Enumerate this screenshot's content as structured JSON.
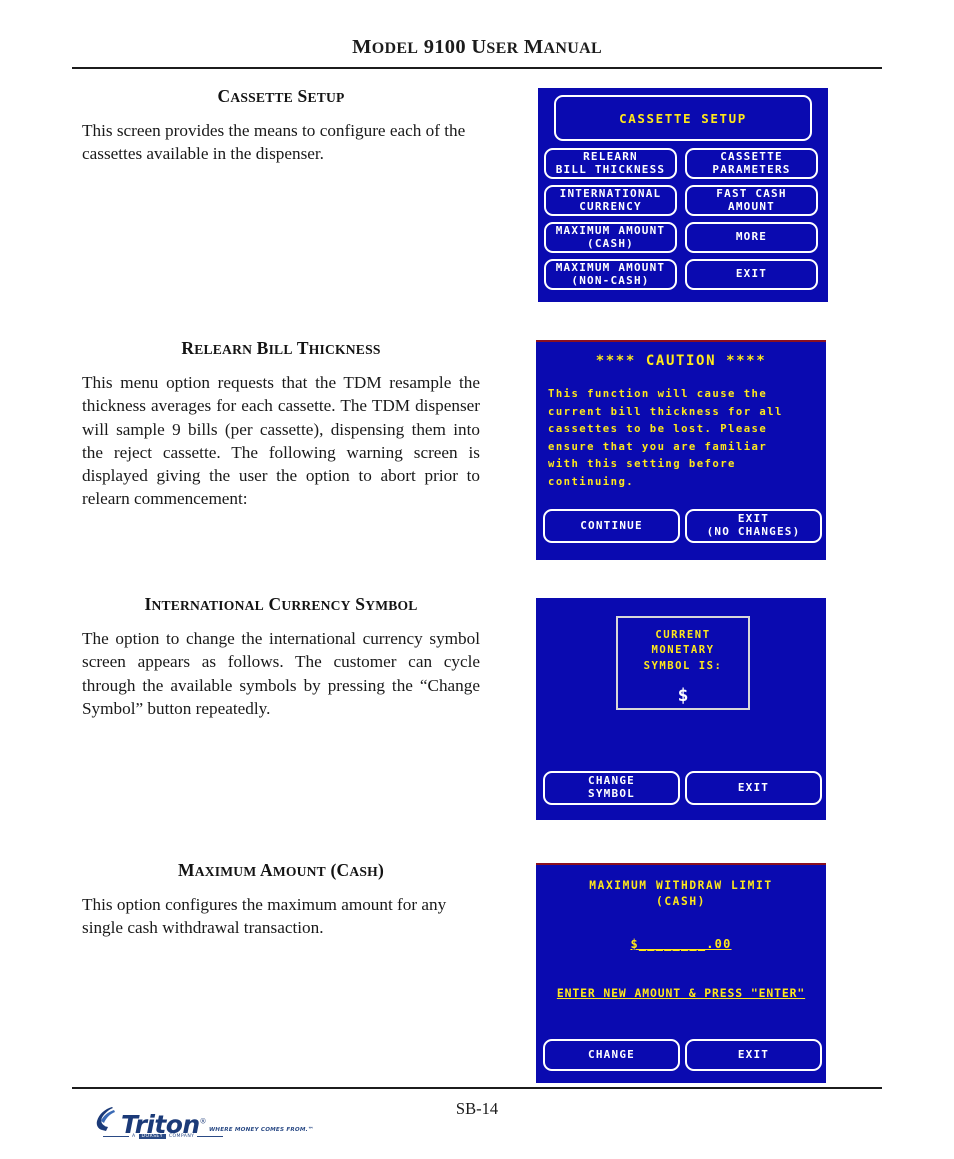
{
  "header": {
    "title_parts": [
      {
        "t": "M",
        "big": true
      },
      {
        "t": "ODEL ",
        "big": false
      },
      {
        "t": "9100 ",
        "big": true
      },
      {
        "t": "U",
        "big": true
      },
      {
        "t": "SER ",
        "big": false
      },
      {
        "t": "M",
        "big": true
      },
      {
        "t": "ANUAL",
        "big": false
      }
    ],
    "title_plain": "MODEL 9100 USER MANUAL"
  },
  "sections": [
    {
      "heading": "CASSETTE SETUP",
      "body": "This screen provides the means to configure each of the cassettes available in the dispenser."
    },
    {
      "heading": "RELEARN BILL THICKNESS",
      "body": "This menu option requests that the TDM resample the thickness averages for each cassette.  The TDM dispenser will sample 9 bills (per cassette), dispensing them into the reject cassette.  The following warning screen is displayed giving the user the option to abort prior to relearn commencement:"
    },
    {
      "heading": "INTERNATIONAL CURRENCY SYMBOL",
      "body": "The option to change the international currency symbol screen appears as follows. The customer can cycle through the available symbols by pressing the “Change Symbol” button repeatedly."
    },
    {
      "heading": "MAXIMUM AMOUNT (CASH)",
      "body": "This option configures the maximum amount for any single cash withdrawal transaction."
    }
  ],
  "screens": {
    "cassette_setup": {
      "title": "CASSETTE SETUP",
      "buttons": [
        {
          "line1": "RELEARN",
          "line2": "BILL THICKNESS"
        },
        {
          "line1": "CASSETTE",
          "line2": "PARAMETERS"
        },
        {
          "line1": "INTERNATIONAL",
          "line2": "CURRENCY"
        },
        {
          "line1": "FAST CASH",
          "line2": "AMOUNT"
        },
        {
          "line1": "MAXIMUM AMOUNT",
          "line2": "(CASH)"
        },
        {
          "line1": "MORE",
          "line2": ""
        },
        {
          "line1": "MAXIMUM AMOUNT",
          "line2": "(NON-CASH)"
        },
        {
          "line1": "EXIT",
          "line2": ""
        }
      ]
    },
    "caution": {
      "title": "**** CAUTION ****",
      "body_lines": [
        "This function will cause the",
        "current bill thickness for all",
        "cassettes to be lost. Please",
        "ensure that you are familiar",
        "with this setting before",
        "continuing."
      ],
      "buttons": [
        {
          "line1": "CONTINUE",
          "line2": ""
        },
        {
          "line1": "EXIT",
          "line2": "(NO CHANGES)"
        }
      ]
    },
    "currency_symbol": {
      "box_lines": [
        "CURRENT",
        "MONETARY",
        "SYMBOL IS:"
      ],
      "symbol": "$",
      "buttons": [
        {
          "line1": "CHANGE",
          "line2": "SYMBOL"
        },
        {
          "line1": "EXIT",
          "line2": ""
        }
      ]
    },
    "max_amount": {
      "title_line1": "MAXIMUM WITHDRAW LIMIT",
      "title_line2": "(CASH)",
      "amount_value": "$________.00",
      "prompt": "ENTER NEW AMOUNT & PRESS \"ENTER\"",
      "buttons": [
        {
          "line1": "CHANGE",
          "line2": ""
        },
        {
          "line1": "EXIT",
          "line2": ""
        }
      ]
    }
  },
  "footer": {
    "page_number": "SB-14",
    "logo_wordmark": "Triton",
    "logo_tagline": "WHERE MONEY COMES FROM.",
    "logo_tm": "™",
    "logo_sub_left": "A",
    "logo_sub_chip": "DORSEY",
    "logo_sub_right": "COMPANY"
  },
  "colors": {
    "screen_bg": "#0a0ab0",
    "screen_yellow": "#ffe81a",
    "screen_white": "#ffffff",
    "logo_blue": "#1b3a78",
    "ink": "#1a1a1a"
  }
}
